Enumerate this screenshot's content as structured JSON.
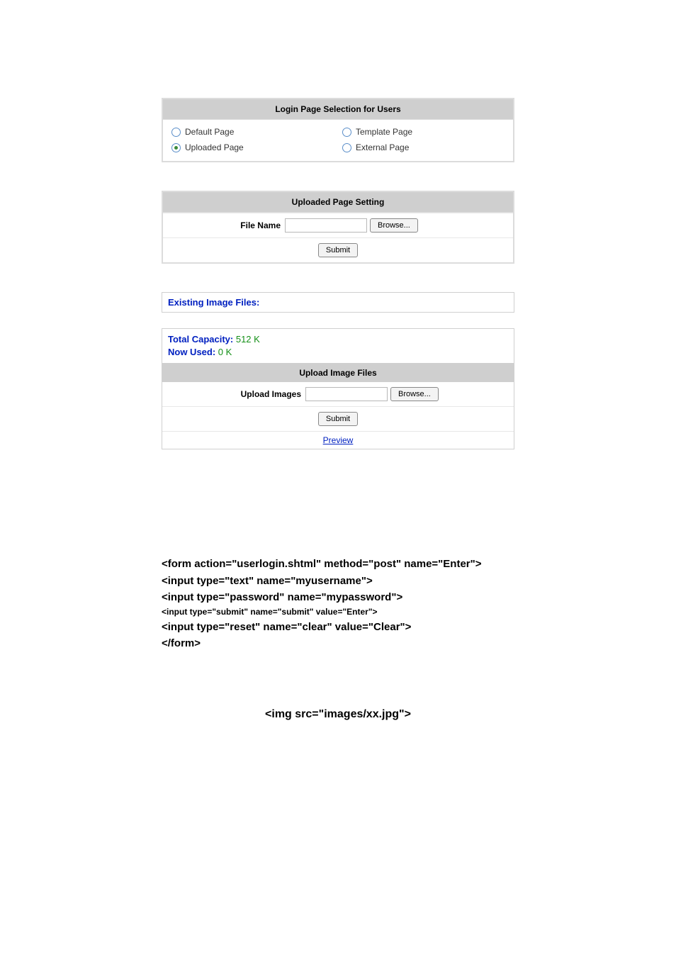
{
  "login_selection": {
    "header": "Login Page Selection for Users",
    "options": [
      {
        "label": "Default Page",
        "selected": false
      },
      {
        "label": "Template Page",
        "selected": false
      },
      {
        "label": "Uploaded Page",
        "selected": true
      },
      {
        "label": "External Page",
        "selected": false
      }
    ]
  },
  "uploaded_setting": {
    "header": "Uploaded Page Setting",
    "file_label": "File Name",
    "file_value": "",
    "browse_label": "Browse...",
    "submit_label": "Submit"
  },
  "existing_files": {
    "title": "Existing Image Files:"
  },
  "capacity": {
    "total_label": "Total Capacity:",
    "total_value": "512 K",
    "used_label": "Now Used:",
    "used_value": "0 K"
  },
  "upload_images": {
    "header": "Upload Image Files",
    "label": "Upload Images",
    "file_value": "",
    "browse_label": "Browse...",
    "submit_label": "Submit",
    "preview_label": "Preview"
  },
  "code_sample": {
    "l1": "<form action=\"userlogin.shtml\" method=\"post\" name=\"Enter\">",
    "l2": "<input type=\"text\" name=\"myusername\">",
    "l3": "<input type=\"password\" name=\"mypassword\">",
    "l4": "<input type=\"submit\" name=\"submit\" value=\"Enter\">",
    "l5": "<input type=\"reset\" name=\"clear\" value=\"Clear\">",
    "l6": "</form>"
  },
  "img_sample": "<img src=\"images/xx.jpg\">"
}
